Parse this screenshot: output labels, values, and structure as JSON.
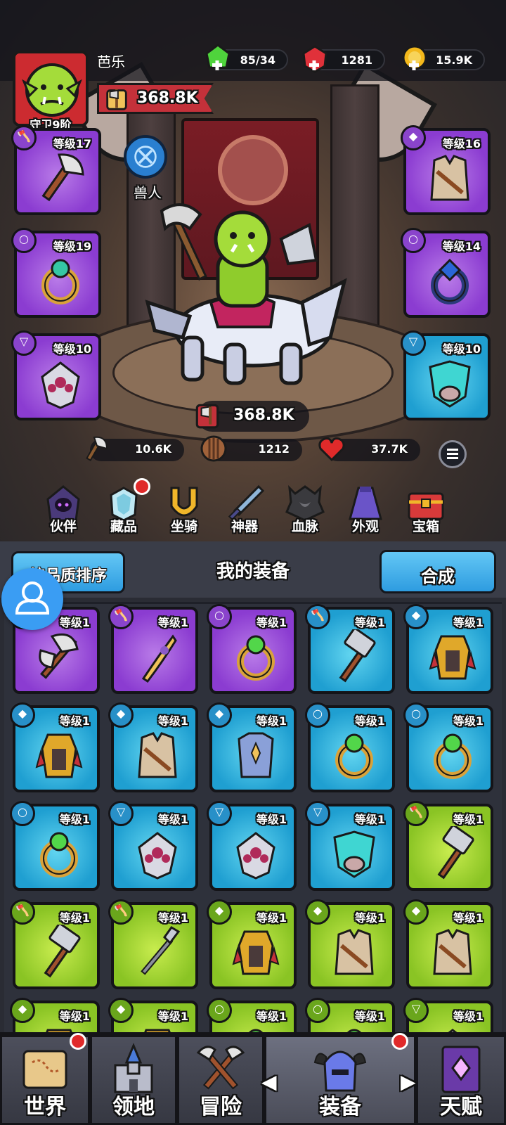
{
  "player": {
    "name": "芭乐",
    "title": "守卫9阶",
    "power": "368.8K"
  },
  "resources": {
    "energy": "85/34",
    "gems": "1281",
    "gold": "15.9K"
  },
  "race": {
    "label": "兽人"
  },
  "equipped": [
    {
      "slot": "weapon",
      "level": "等级17",
      "rarity": "purple",
      "icon": "axe-icon"
    },
    {
      "slot": "armor",
      "level": "等级16",
      "rarity": "purple",
      "icon": "vest-icon"
    },
    {
      "slot": "ring",
      "level": "等级19",
      "rarity": "purple",
      "icon": "ring-icon"
    },
    {
      "slot": "ring",
      "level": "等级14",
      "rarity": "purple",
      "icon": "ring-icon"
    },
    {
      "slot": "necklace",
      "level": "等级10",
      "rarity": "purple",
      "icon": "amulet-icon"
    },
    {
      "slot": "helmet",
      "level": "等级10",
      "rarity": "blue",
      "icon": "mask-icon"
    }
  ],
  "stats": {
    "power": "368.8K",
    "attack": "10.6K",
    "defense": "1212",
    "hp": "37.7K"
  },
  "menu": [
    {
      "label": "伙伴",
      "icon": "hooded-partner-icon",
      "badge": false
    },
    {
      "label": "藏品",
      "icon": "crystal-icon",
      "badge": true
    },
    {
      "label": "坐骑",
      "icon": "horseshoe-icon",
      "badge": false
    },
    {
      "label": "神器",
      "icon": "sword-icon",
      "badge": false
    },
    {
      "label": "血脉",
      "icon": "bloodline-icon",
      "badge": false
    },
    {
      "label": "外观",
      "icon": "cape-icon",
      "badge": false
    },
    {
      "label": "宝箱",
      "icon": "chest-icon",
      "badge": false
    }
  ],
  "inventory": {
    "sort_label": "按品质排序",
    "title": "我的装备",
    "merge_label": "合成",
    "items": [
      {
        "level": "等级1",
        "rarity": "purple",
        "type": "weapon",
        "icon": "double-axe-icon"
      },
      {
        "level": "等级1",
        "rarity": "purple",
        "type": "weapon",
        "icon": "dagger-icon"
      },
      {
        "level": "等级1",
        "rarity": "purple",
        "type": "ring",
        "icon": "ring-icon"
      },
      {
        "level": "等级1",
        "rarity": "blue",
        "type": "weapon",
        "icon": "hammer-icon"
      },
      {
        "level": "等级1",
        "rarity": "blue",
        "type": "armor",
        "icon": "armor-icon"
      },
      {
        "level": "等级1",
        "rarity": "blue",
        "type": "armor",
        "icon": "armor-icon"
      },
      {
        "level": "等级1",
        "rarity": "blue",
        "type": "armor",
        "icon": "vest-icon"
      },
      {
        "level": "等级1",
        "rarity": "blue",
        "type": "armor",
        "icon": "tunic-icon"
      },
      {
        "level": "等级1",
        "rarity": "blue",
        "type": "ring",
        "icon": "ring-icon"
      },
      {
        "level": "等级1",
        "rarity": "blue",
        "type": "ring",
        "icon": "ring-icon"
      },
      {
        "level": "等级1",
        "rarity": "blue",
        "type": "ring",
        "icon": "ring-icon"
      },
      {
        "level": "等级1",
        "rarity": "blue",
        "type": "necklace",
        "icon": "amulet-icon"
      },
      {
        "level": "等级1",
        "rarity": "blue",
        "type": "necklace",
        "icon": "amulet-icon"
      },
      {
        "level": "等级1",
        "rarity": "blue",
        "type": "necklace",
        "icon": "mask-icon"
      },
      {
        "level": "等级1",
        "rarity": "green",
        "type": "weapon",
        "icon": "hammer-icon"
      },
      {
        "level": "等级1",
        "rarity": "green",
        "type": "weapon",
        "icon": "hammer-icon"
      },
      {
        "level": "等级1",
        "rarity": "green",
        "type": "weapon",
        "icon": "spear-icon"
      },
      {
        "level": "等级1",
        "rarity": "green",
        "type": "armor",
        "icon": "armor-icon"
      },
      {
        "level": "等级1",
        "rarity": "green",
        "type": "armor",
        "icon": "vest-icon"
      },
      {
        "level": "等级1",
        "rarity": "green",
        "type": "armor",
        "icon": "vest-icon"
      },
      {
        "level": "等级1",
        "rarity": "green",
        "type": "armor",
        "icon": "armor-icon"
      },
      {
        "level": "等级1",
        "rarity": "green",
        "type": "armor",
        "icon": "armor-icon"
      },
      {
        "level": "等级1",
        "rarity": "green",
        "type": "ring",
        "icon": "ring-icon"
      },
      {
        "level": "等级1",
        "rarity": "green",
        "type": "ring",
        "icon": "ring-icon"
      },
      {
        "level": "等级1",
        "rarity": "green",
        "type": "necklace",
        "icon": "amulet-icon"
      }
    ]
  },
  "nav": [
    {
      "label": "世界",
      "icon": "map-scroll-icon",
      "badge": true
    },
    {
      "label": "领地",
      "icon": "castle-icon",
      "badge": false
    },
    {
      "label": "冒险",
      "icon": "crossed-axes-icon",
      "badge": false
    },
    {
      "label": "装备",
      "icon": "horned-helmet-icon",
      "badge": true,
      "active": true
    },
    {
      "label": "天赋",
      "icon": "spellbook-icon",
      "badge": false
    }
  ],
  "colors": {
    "purple": "#8b3cd1",
    "blue": "#1f9fd1",
    "green": "#8ac424",
    "badge_red": "#e02a2a",
    "button_blue": "#2e9ce0"
  }
}
